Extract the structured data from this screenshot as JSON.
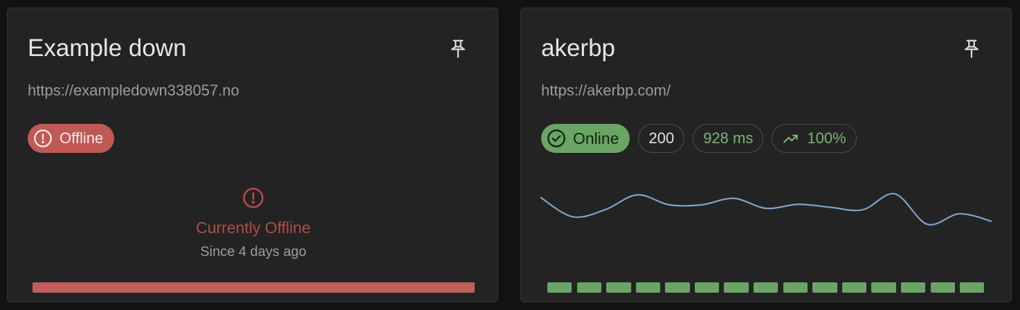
{
  "cards": [
    {
      "title": "Example down",
      "url": "https://exampledown338057.no",
      "status": "Offline",
      "offline_message": "Currently Offline",
      "since": "Since 4 days ago",
      "pin_icon": "pin-icon",
      "status_icon": "alert-circle-icon",
      "colors": {
        "status_bg": "#bf5954",
        "bar": "#c05e5b",
        "message": "#b04d4a"
      }
    },
    {
      "title": "akerbp",
      "url": "https://akerbp.com/",
      "status": "Online",
      "status_code": "200",
      "response_time": "928 ms",
      "uptime": "100%",
      "pin_icon": "pin-icon",
      "status_icon": "check-circle-icon",
      "uptime_icon": "trending-up-icon",
      "uptime_ticks": [
        "up",
        "up",
        "up",
        "up",
        "up",
        "up",
        "up",
        "up",
        "up",
        "up",
        "up",
        "up",
        "up",
        "up",
        "up"
      ],
      "colors": {
        "status_bg": "#6aa565",
        "tick": "#6aa565",
        "line": "#7fa3cc"
      }
    }
  ],
  "chart_data": {
    "type": "line",
    "series": [
      {
        "values": [
          0.1,
          0.49,
          0.35,
          0.05,
          0.25,
          0.25,
          0.12,
          0.32,
          0.24,
          0.3,
          0.35,
          0.03,
          0.64,
          0.43,
          0.58
        ]
      }
    ]
  }
}
